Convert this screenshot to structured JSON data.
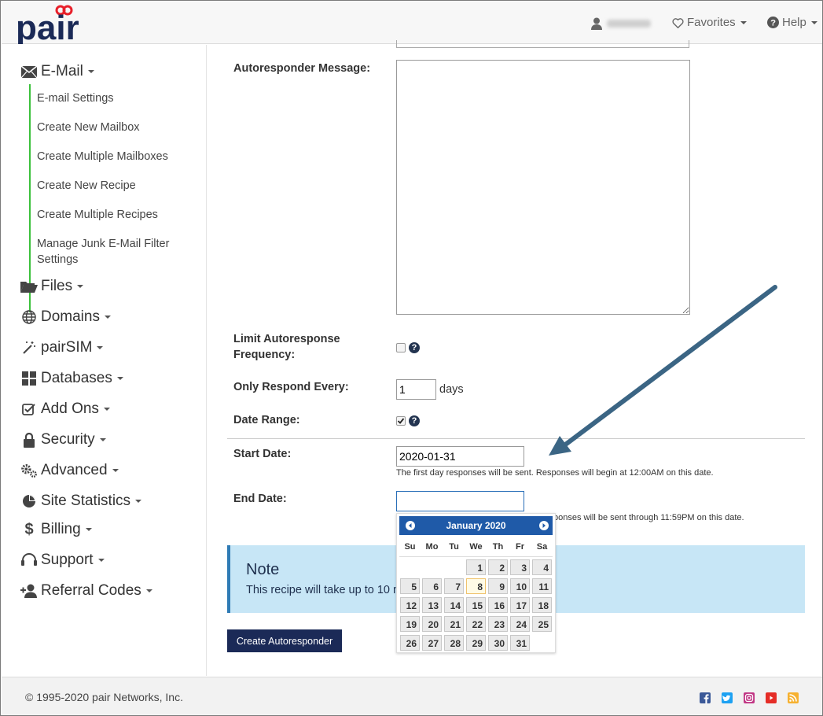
{
  "header": {
    "logo_text": "pair",
    "favorites_label": "Favorites",
    "help_label": "Help"
  },
  "sidebar": {
    "email": "E-Mail",
    "email_items": [
      "E-mail Settings",
      "Create New Mailbox",
      "Create Multiple Mailboxes",
      "Create New Recipe",
      "Create Multiple Recipes",
      "Manage Junk E-Mail Filter Settings"
    ],
    "files": "Files",
    "domains": "Domains",
    "pairsim": "pairSIM",
    "databases": "Databases",
    "addons": "Add Ons",
    "security": "Security",
    "advanced": "Advanced",
    "site_statistics": "Site Statistics",
    "billing": "Billing",
    "support": "Support",
    "referral_codes": "Referral Codes"
  },
  "form": {
    "autoresponder_message_label": "Autoresponder Message:",
    "limit_label": "Limit Autoresponse Frequency:",
    "only_respond_label": "Only Respond Every:",
    "only_respond_value": "1",
    "days_label": "days",
    "date_range_label": "Date Range:",
    "start_date_label": "Start Date:",
    "start_date_value": "2020-01-31",
    "start_date_hint": "The first day responses will be sent. Responses will begin at 12:00AM on this date.",
    "end_date_label": "End Date:",
    "end_date_value": "",
    "end_date_hint": "ponses will be sent through 11:59PM on this date.",
    "help_glyph": "?"
  },
  "calendar": {
    "title": "January 2020",
    "weekdays": [
      "Su",
      "Mo",
      "Tu",
      "We",
      "Th",
      "Fr",
      "Sa"
    ],
    "weeks": [
      [
        "",
        "",
        "",
        "1",
        "2",
        "3",
        "4"
      ],
      [
        "5",
        "6",
        "7",
        "8",
        "9",
        "10",
        "11"
      ],
      [
        "12",
        "13",
        "14",
        "15",
        "16",
        "17",
        "18"
      ],
      [
        "19",
        "20",
        "21",
        "22",
        "23",
        "24",
        "25"
      ],
      [
        "26",
        "27",
        "28",
        "29",
        "30",
        "31",
        ""
      ]
    ],
    "today": "8"
  },
  "note": {
    "title": "Note",
    "text": "This recipe will take up to 10 m"
  },
  "create_button": "Create Autoresponder",
  "footer": {
    "copyright": "© 1995-2020 pair Networks, Inc."
  },
  "colors": {
    "brand_navy": "#1b2a57",
    "logo_red": "#e8202a",
    "submenu_green": "#3cc13c",
    "note_bg": "#c7e6f6",
    "calendar_header": "#1f5aa8",
    "arrow": "#3b6584"
  },
  "icons": [
    "envelope-icon",
    "folder-icon",
    "globe-icon",
    "magic-wand-icon",
    "grid-icon",
    "checkbox-icon",
    "lock-icon",
    "gears-icon",
    "pie-chart-icon",
    "dollar-icon",
    "headset-icon",
    "user-plus-icon",
    "heart-icon",
    "question-circle-icon",
    "user-icon",
    "facebook-icon",
    "twitter-icon",
    "instagram-icon",
    "youtube-icon",
    "rss-icon"
  ]
}
